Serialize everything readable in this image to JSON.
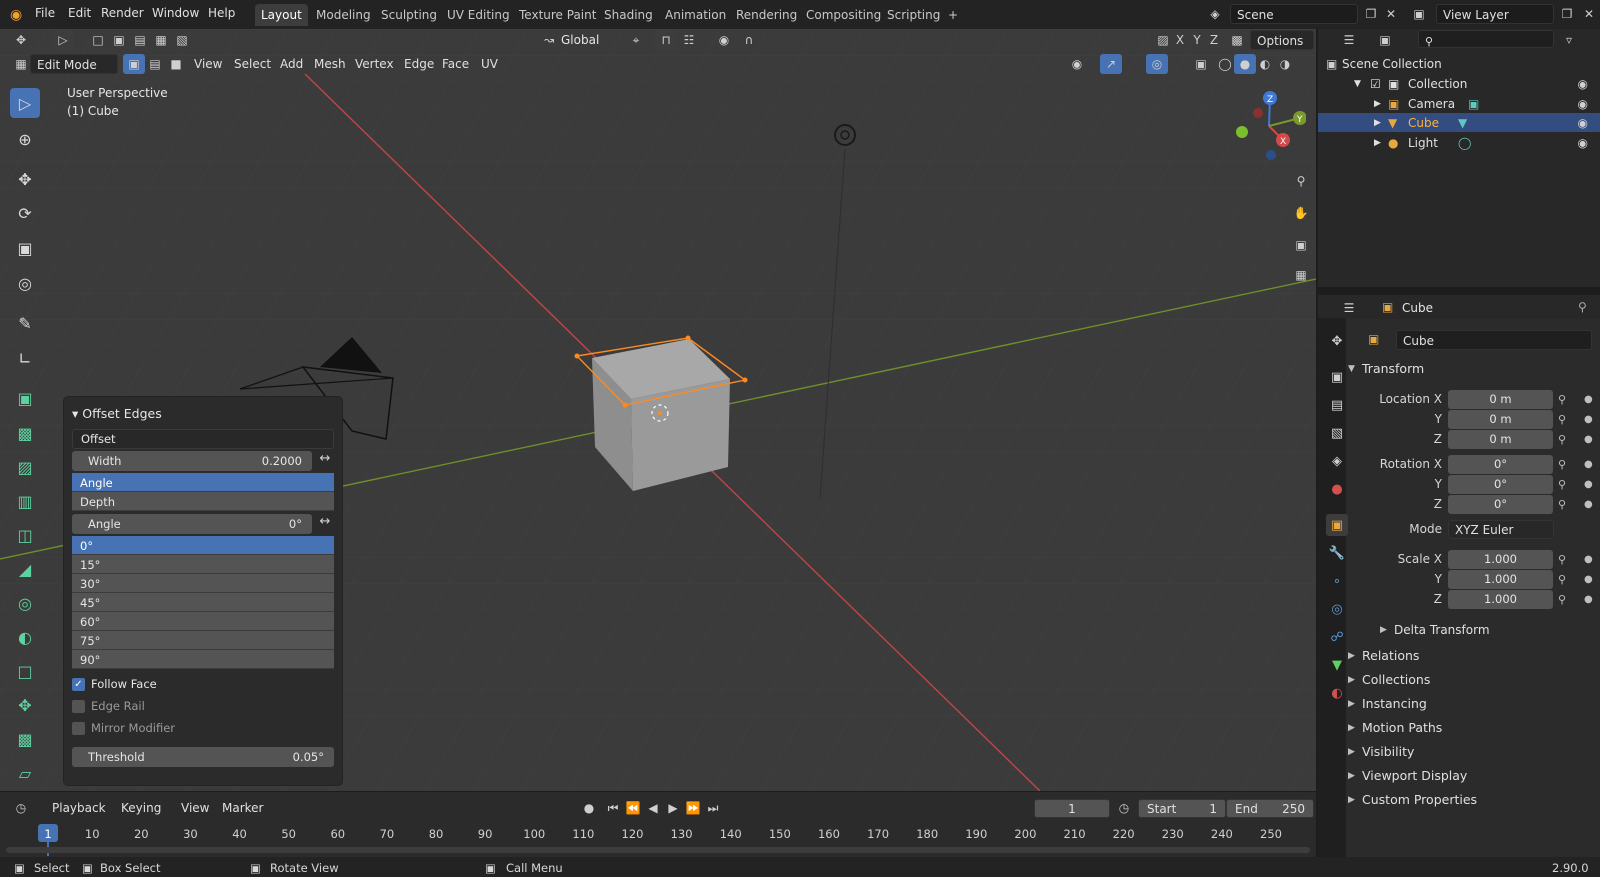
{
  "menus": [
    "File",
    "Edit",
    "Render",
    "Window",
    "Help"
  ],
  "workspaces": [
    "Layout",
    "Modeling",
    "Sculpting",
    "UV Editing",
    "Texture Paint",
    "Shading",
    "Animation",
    "Rendering",
    "Compositing",
    "Scripting"
  ],
  "scene_name": "Scene",
  "view_layer": "View Layer",
  "viewport_header": {
    "mode": "Edit Mode",
    "menus": [
      "View",
      "Select",
      "Add",
      "Mesh",
      "Vertex",
      "Edge",
      "Face",
      "UV"
    ],
    "transform_orientation": "Global",
    "axes": [
      "X",
      "Y",
      "Z"
    ],
    "options_label": "Options"
  },
  "viewport_overlay": {
    "line1": "User Perspective",
    "line2": "(1) Cube"
  },
  "operator_panel": {
    "title": "Offset Edges",
    "mode_dropdown": "Offset",
    "width_label": "Width",
    "width_value": "0.2000",
    "geometry_options": [
      "Angle",
      "Depth"
    ],
    "geometry_selected": "Angle",
    "angle_label": "Angle",
    "angle_value": "0°",
    "angle_presets": [
      "0°",
      "15°",
      "30°",
      "45°",
      "60°",
      "75°",
      "90°"
    ],
    "angle_selected": "0°",
    "follow_face": "Follow Face",
    "follow_face_checked": true,
    "edge_rail": "Edge Rail",
    "mirror_modifier": "Mirror Modifier",
    "threshold_label": "Threshold",
    "threshold_value": "0.05°"
  },
  "outliner": {
    "root": "Scene Collection",
    "collection": "Collection",
    "items": [
      "Camera",
      "Cube",
      "Light"
    ],
    "selected": "Cube"
  },
  "properties": {
    "header_object": "Cube",
    "object_name": "Cube",
    "transform_label": "Transform",
    "location_label": "Location X",
    "rotation_label": "Rotation X",
    "scale_label": "Scale X",
    "y_label": "Y",
    "z_label": "Z",
    "location": [
      "0 m",
      "0 m",
      "0 m"
    ],
    "rotation": [
      "0°",
      "0°",
      "0°"
    ],
    "mode_label": "Mode",
    "mode_value": "XYZ Euler",
    "scale": [
      "1.000",
      "1.000",
      "1.000"
    ],
    "delta_transform": "Delta Transform",
    "panels": [
      "Relations",
      "Collections",
      "Instancing",
      "Motion Paths",
      "Visibility",
      "Viewport Display",
      "Custom Properties"
    ]
  },
  "timeline": {
    "menus": [
      "Playback",
      "Keying",
      "View",
      "Marker"
    ],
    "current_frame": "1",
    "start_label": "Start",
    "start_value": "1",
    "end_label": "End",
    "end_value": "250",
    "ticks": [
      "1",
      "10",
      "20",
      "30",
      "40",
      "50",
      "60",
      "70",
      "80",
      "90",
      "100",
      "110",
      "120",
      "130",
      "140",
      "150",
      "160",
      "170",
      "180",
      "190",
      "200",
      "210",
      "220",
      "230",
      "240",
      "250"
    ]
  },
  "statusbar": {
    "select": "Select",
    "box_select": "Box Select",
    "rotate_view": "Rotate View",
    "call_menu": "Call Menu",
    "version": "2.90.0"
  },
  "colors": {
    "accent": "#4772b3",
    "selection": "#334d80",
    "x_axis": "#d44a4a",
    "y_axis": "#7a9a2e",
    "z_axis": "#3f79d6",
    "edge_selected": "#ff8a1f"
  }
}
